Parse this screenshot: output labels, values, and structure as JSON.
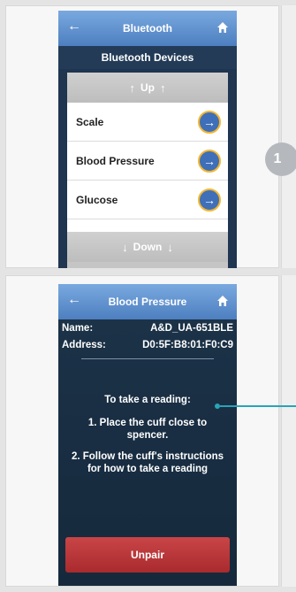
{
  "step_badge": "1",
  "screen1": {
    "title": "Bluetooth",
    "subtitle": "Bluetooth Devices",
    "up_label": "Up",
    "down_label": "Down",
    "devices": [
      {
        "label": "Scale"
      },
      {
        "label": "Blood Pressure"
      },
      {
        "label": "Glucose"
      }
    ]
  },
  "screen2": {
    "title": "Blood Pressure",
    "name_label": "Name:",
    "name_value": "A&D_UA-651BLE",
    "address_label": "Address:",
    "address_value": "D0:5F:B8:01:F0:C9",
    "instructions_title": "To take a reading:",
    "step1": "1. Place the cuff close to spencer.",
    "step2": "2. Follow the cuff's instructions for how to take a reading",
    "unpair_label": "Unpair"
  },
  "icons": {
    "back": "←",
    "home": "home-icon",
    "arrow_up": "↑",
    "arrow_down": "↓",
    "arrow_right": "→"
  },
  "colors": {
    "titlebar": "#5b8cd0",
    "accent_ring": "#f2b632",
    "unpair": "#b83336",
    "callout": "#2aa3b8"
  }
}
